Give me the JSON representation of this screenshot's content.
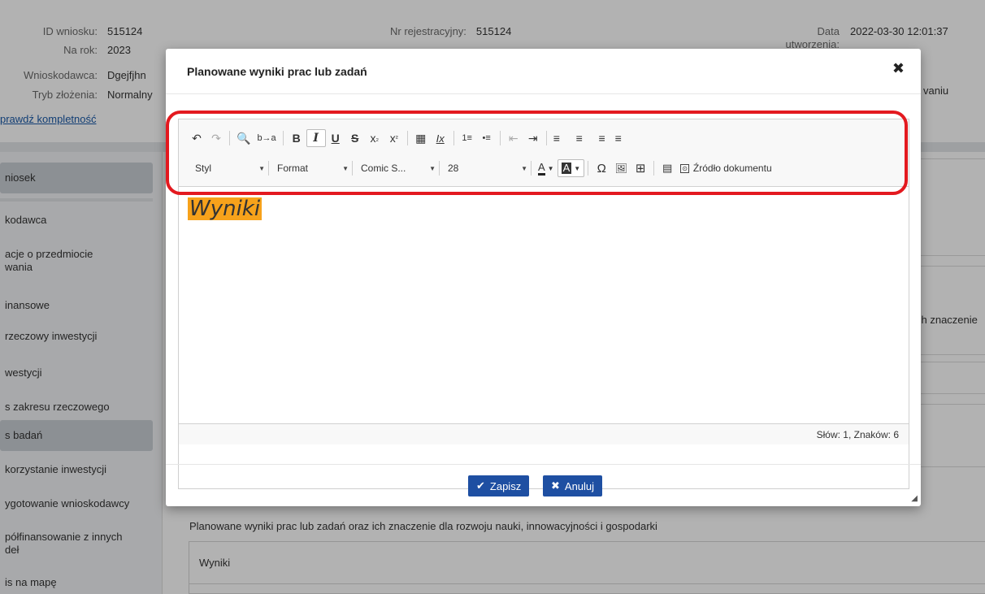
{
  "header": {
    "fields": [
      {
        "label": "ID wniosku:",
        "value": "515124"
      },
      {
        "label": "Na rok:",
        "value": "2023"
      },
      {
        "label": "Wnioskodawca:",
        "value": "Dgejfjhn"
      },
      {
        "label": "Tryb złożenia:",
        "value": "Normalny"
      }
    ],
    "reg_label": "Nr rejestracyjny:",
    "reg_value": "515124",
    "date_label_line1": "Data",
    "date_label_line2": "utworzenia:",
    "date_value": "2022-03-30 12:01:37",
    "right_fragment": "vaniu",
    "check_link": "prawdź kompletność"
  },
  "sidebar": {
    "items": [
      "niosek",
      "kodawca",
      "acje o przedmiocie",
      "wania",
      "inansowe",
      "rzeczowy inwestycji",
      "westycji",
      "s zakresu rzeczowego",
      "s badań",
      "korzystanie inwestycji",
      "ygotowanie wnioskodawcy",
      "półfinansowanie z innych",
      "deł",
      "is na mapę"
    ]
  },
  "content": {
    "right_fragment": "ch znaczenie",
    "note": "Planowane wyniki prac lub zadań oraz ich znaczenie dla rozwoju nauki, innowacyjności i gospodarki",
    "table_cell": "Wyniki"
  },
  "modal": {
    "title": "Planowane wyniki prac lub zadań",
    "close_glyph": "✖",
    "toolbar": {
      "undo": "↶",
      "redo": "↷",
      "find": "🔍",
      "replace": "b→a",
      "bold": "B",
      "italic": "I",
      "underline": "U",
      "strike": "S",
      "subscript": "x",
      "superscript": "x",
      "paste": "▦",
      "clear_format": "Ix",
      "numbered_list": "1≡",
      "bullet_list": "•≡",
      "outdent": "⇤",
      "indent": "⇥",
      "align_left": "≡",
      "align_center": "≡",
      "align_right": "≡",
      "align_justify": "≡",
      "style_label": "Styl",
      "format_label": "Format",
      "font_label": "Comic S...",
      "size_label": "28",
      "text_color": "A",
      "bg_color": "A",
      "special_char": "Ω",
      "image": "🖼",
      "table": "⊞",
      "templates": "▤",
      "source_label": "Źródło dokumentu"
    },
    "editor_text": "Wyniki",
    "status": "Słów: 1, Znaków: 6",
    "save_label": "Zapisz",
    "cancel_label": "Anuluj"
  },
  "colors": {
    "accent": "#1e4fa2",
    "highlight": "#f7a21b",
    "annotation": "#e3191f"
  }
}
